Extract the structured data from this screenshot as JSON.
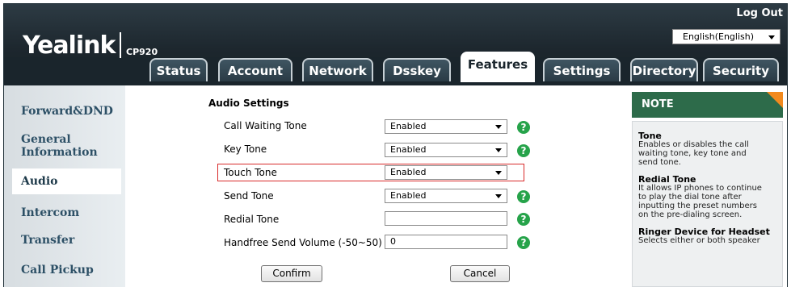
{
  "header": {
    "logo": "Yealink",
    "model": "CP920",
    "logout": "Log Out",
    "language": "English(English)"
  },
  "tabs": [
    {
      "label": "Status"
    },
    {
      "label": "Account"
    },
    {
      "label": "Network"
    },
    {
      "label": "Dsskey"
    },
    {
      "label": "Features",
      "active": true
    },
    {
      "label": "Settings"
    },
    {
      "label": "Directory"
    },
    {
      "label": "Security"
    }
  ],
  "sidebar": {
    "items": [
      {
        "label": "Forward&DND"
      },
      {
        "label": "General"
      },
      {
        "label": "Information"
      },
      {
        "label": "Audio",
        "active": true
      },
      {
        "label": "Intercom"
      },
      {
        "label": "Transfer"
      },
      {
        "label": "Call Pickup"
      }
    ]
  },
  "main": {
    "section_title": "Audio Settings",
    "rows": [
      {
        "label": "Call Waiting Tone",
        "value": "Enabled",
        "type": "select"
      },
      {
        "label": "Key Tone",
        "value": "Enabled",
        "type": "select"
      },
      {
        "label": "Touch Tone",
        "value": "Enabled",
        "type": "select"
      },
      {
        "label": "Send Tone",
        "value": "Enabled",
        "type": "select"
      },
      {
        "label": "Redial Tone",
        "value": "",
        "type": "text"
      },
      {
        "label": "Handfree Send Volume (-50~50)",
        "value": "0",
        "type": "text"
      }
    ],
    "help_glyph": "?",
    "confirm": "Confirm",
    "cancel": "Cancel"
  },
  "note": {
    "header": "NOTE",
    "sections": [
      {
        "title": "Tone",
        "lines": [
          "Enables or disables the call",
          "waiting tone, key tone and",
          "send tone."
        ]
      },
      {
        "title": "Redial Tone",
        "lines": [
          "It allows IP phones to continue",
          "to play the dial tone after",
          "inputting the preset numbers",
          "on the pre-dialing screen."
        ]
      },
      {
        "title": "Ringer Device for Headset",
        "lines": [
          "Selects either or both speaker"
        ]
      }
    ]
  },
  "colors": {
    "header_bg": "#1d272e",
    "note_header": "#2d6b4a",
    "note_corner": "#f28a1e",
    "help_icon": "#26a34a",
    "highlight_border": "#d82b2b"
  }
}
